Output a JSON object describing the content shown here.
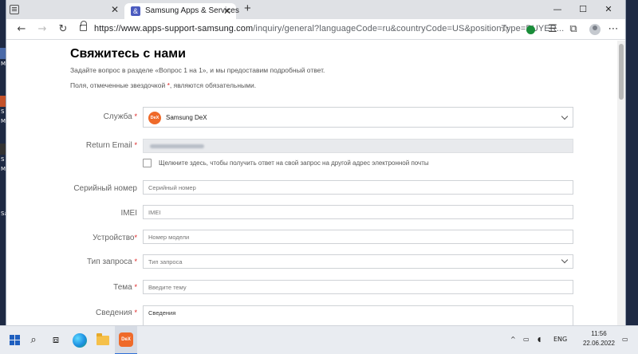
{
  "desktop": {
    "labels": [
      "",
      "M",
      "S",
      "M",
      "S",
      "M",
      "Sa"
    ]
  },
  "browser": {
    "tab_title": "Samsung Apps & Services",
    "tab_favicon": "&",
    "url_host": "https://www.apps-support-samsung.com",
    "url_rest": "/inquiry/general?languageCode=ru&countryCode=US&positionType=BUYER...",
    "new_tab_icon": "plus-icon",
    "controls": {
      "minimize": "—",
      "maximize": "☐",
      "close": "✕"
    }
  },
  "form": {
    "title": "Свяжитесь с нами",
    "subtitle": "Задайте вопрос в разделе «Вопрос 1 на 1», и мы предоставим подробный ответ.",
    "required_note_prefix": "Поля, отмеченные звездочкой ",
    "required_star": "*",
    "required_note_suffix": ", являются обязательными.",
    "service": {
      "label": "Служба",
      "required": "*",
      "value": "Samsung DeX",
      "icon_text": "DeX"
    },
    "return_email": {
      "label": "Return Email",
      "required": "*"
    },
    "alt_email_checkbox": {
      "label": "Щелкните здесь, чтобы получить ответ на свой запрос на другой адрес электронной почты"
    },
    "serial": {
      "label": "Серийный номер",
      "placeholder": "Серийный номер"
    },
    "imei": {
      "label": "IMEI",
      "placeholder": "IMEI"
    },
    "device": {
      "label": "Устройство",
      "required": "*",
      "placeholder": "Номер модели"
    },
    "request_type": {
      "label": "Тип запроса",
      "required": "*",
      "placeholder": "Тип запроса"
    },
    "topic": {
      "label": "Тема",
      "required": "*",
      "placeholder": "Введите тему"
    },
    "details": {
      "label": "Сведения",
      "required": "*",
      "placeholder": "Сведения"
    }
  },
  "taskbar": {
    "dex_icon_text": "DeX",
    "lang": "ENG",
    "time": "11:56",
    "date": "22.06.2022",
    "colors": {
      "accent": "#2f6fd6",
      "dex": "#ef6a2a"
    }
  }
}
